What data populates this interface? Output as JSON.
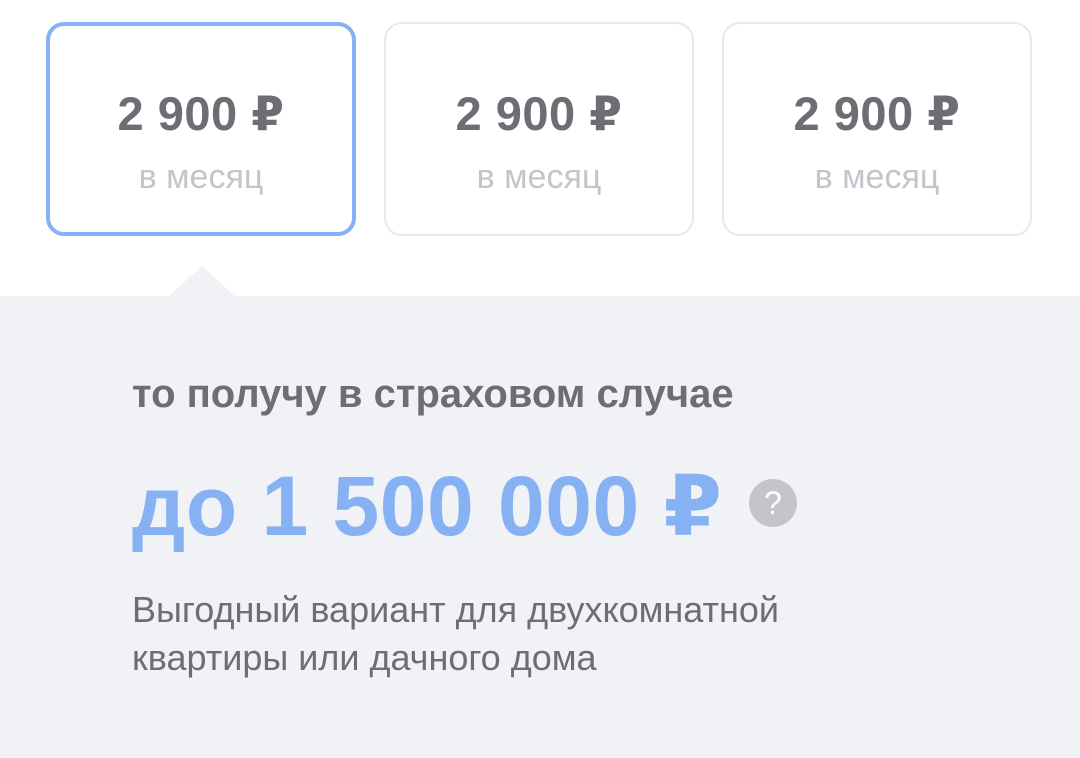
{
  "plans": [
    {
      "price": "2 900 ₽",
      "period": "в месяц",
      "selected": true
    },
    {
      "price": "2 900 ₽",
      "period": "в месяц",
      "selected": false
    },
    {
      "price": "2 900 ₽",
      "period": "в месяц",
      "selected": false
    }
  ],
  "details": {
    "caption": "то получу в страховом случае",
    "amount": "до 1 500 000 ₽",
    "help_icon": "question-icon",
    "help_glyph": "?",
    "description": "Выгодный вариант для двухкомнатной квартиры или дачного дома"
  },
  "colors": {
    "accent": "#86b2f3",
    "text": "#6c6e74",
    "muted": "#c3c5cb",
    "panel": "#f1f2f6"
  }
}
